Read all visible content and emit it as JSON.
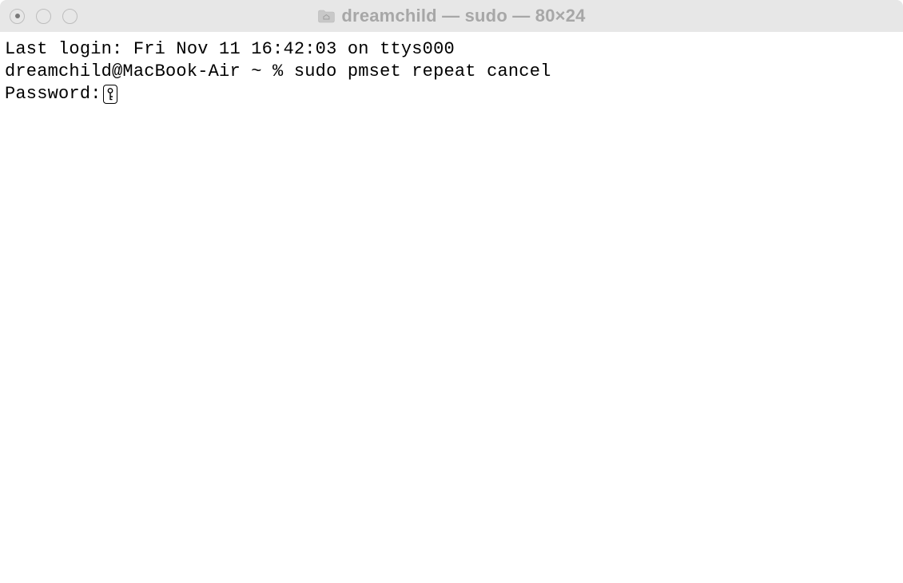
{
  "window": {
    "title": "dreamchild — sudo — 80×24"
  },
  "terminal": {
    "last_login": "Last login: Fri Nov 11 16:42:03 on ttys000",
    "prompt_line": "dreamchild@MacBook-Air ~ % sudo pmset repeat cancel",
    "password_label": "Password:"
  }
}
